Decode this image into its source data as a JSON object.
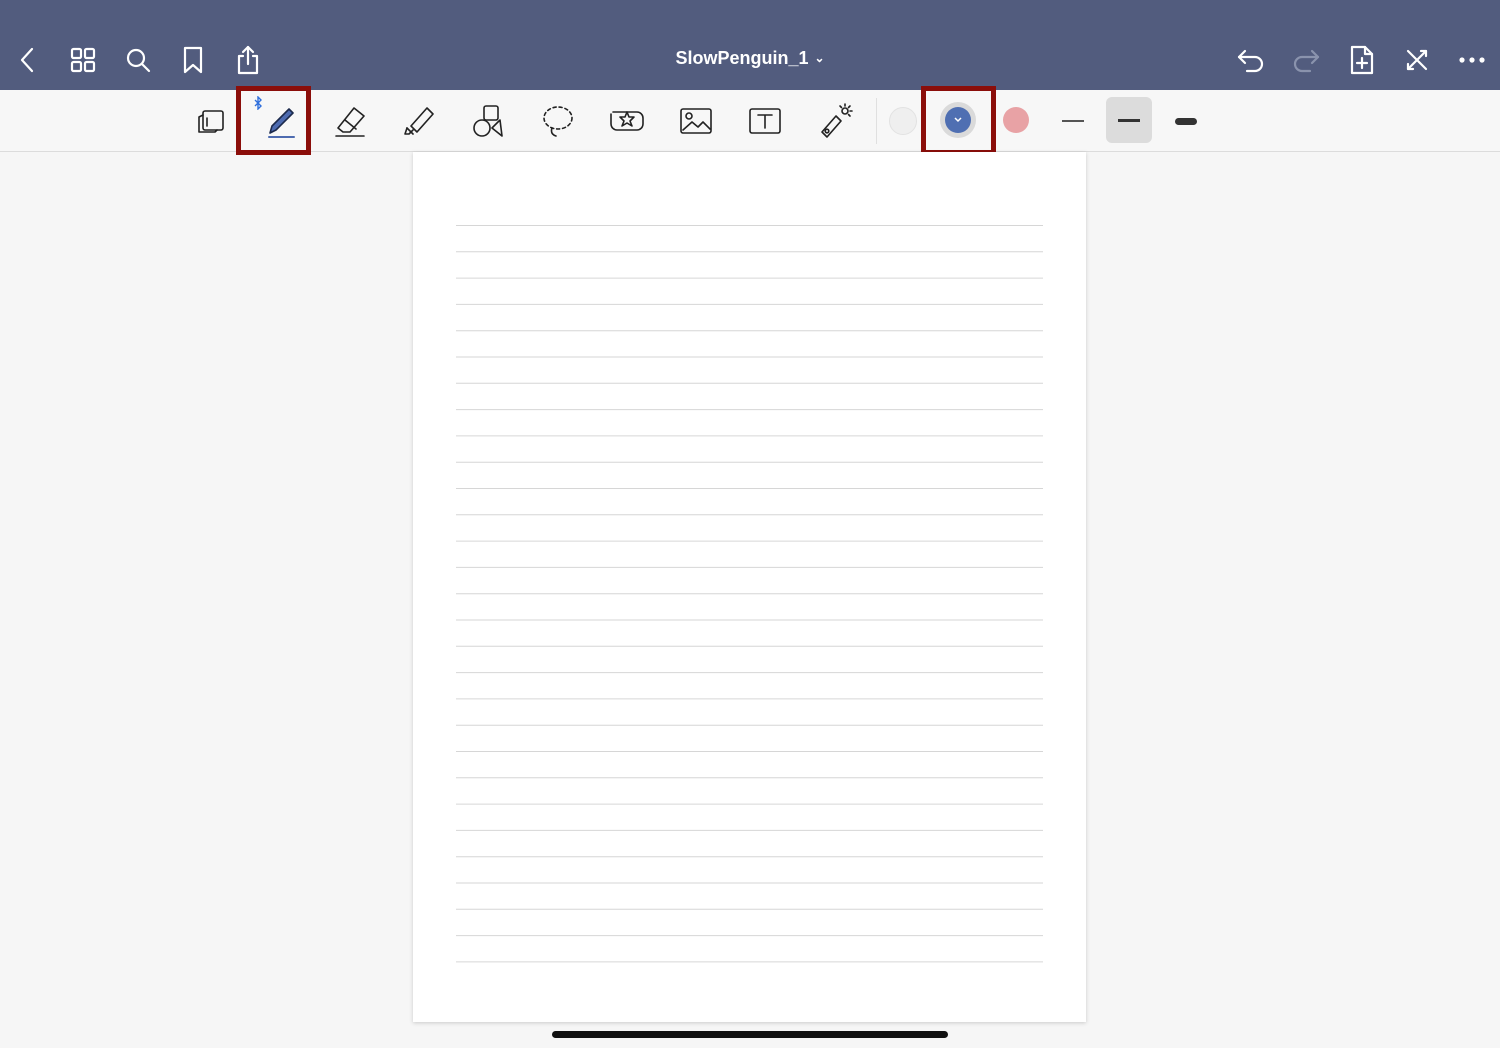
{
  "header": {
    "title": "SlowPenguin_1",
    "title_caret": "⌄",
    "background": "#525c7e"
  },
  "left_icons": [
    "chevron-left-icon",
    "grid-icon",
    "search-icon",
    "bookmark-icon",
    "share-icon"
  ],
  "right_icons": [
    "undo-icon",
    "redo-icon",
    "add-page-icon",
    "close-cross-icon",
    "more-icon"
  ],
  "toolbar": {
    "tools": [
      "read-mode-icon",
      "pen-icon",
      "eraser-icon",
      "highlighter-icon",
      "shapes-icon",
      "lasso-icon",
      "sticker-icon",
      "image-icon",
      "text-icon",
      "laser-pointer-icon"
    ],
    "selected_tool": "pen-icon",
    "bluetooth_badge": "bluetooth-icon",
    "colors": [
      {
        "name": "white",
        "hex": "#efefef"
      },
      {
        "name": "blue",
        "hex": "#4f6fb2",
        "selected": true
      },
      {
        "name": "pink",
        "hex": "#e8a2a5"
      }
    ],
    "thickness_options": [
      "thin",
      "medium",
      "thick"
    ],
    "selected_thickness": "medium",
    "highlight_color": "#8b0e0a"
  },
  "page": {
    "paper": "ruled",
    "line_color": "#d6d6d6"
  }
}
